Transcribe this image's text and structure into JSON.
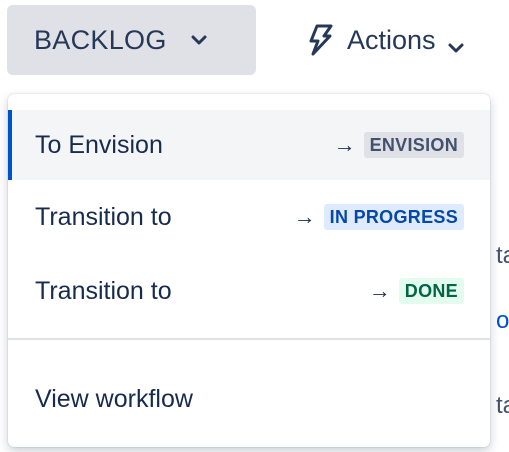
{
  "toolbar": {
    "status_label": "BACKLOG",
    "actions_label": "Actions"
  },
  "background_fragments": {
    "row1": "ta",
    "row2": "o",
    "row3": "ta"
  },
  "menu": {
    "items": [
      {
        "label": "To Envision",
        "arrow": "→",
        "status": "ENVISION",
        "status_color": "#dfe1e6"
      },
      {
        "label": "Transition to",
        "arrow": "→",
        "status": "IN PROGRESS",
        "status_color": "#deebff"
      },
      {
        "label": "Transition to",
        "arrow": "→",
        "status": "DONE",
        "status_color": "#e3fcef"
      }
    ],
    "view_workflow_label": "View workflow"
  },
  "colors": {
    "accent": "#0052cc",
    "button_bg": "#dfe1e6",
    "text": "#172b4d"
  }
}
